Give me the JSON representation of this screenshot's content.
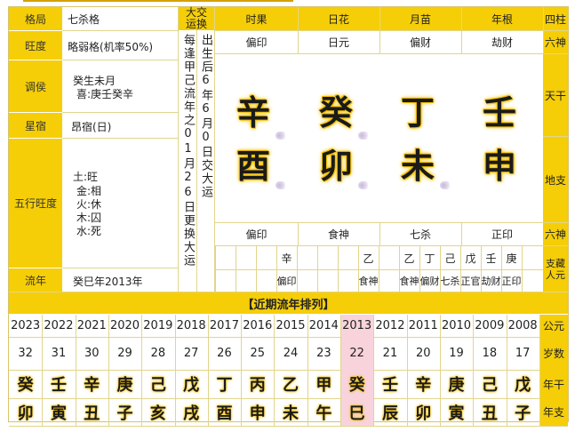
{
  "left": {
    "rows": [
      {
        "label": "格局",
        "value": "七杀格"
      },
      {
        "label": "旺度",
        "value": "略弱格(机率50%)"
      },
      {
        "label": "调侯",
        "lines": [
          "癸生未月",
          "喜:庚壬癸辛"
        ]
      },
      {
        "label": "星宿",
        "value": "昂宿(日)"
      },
      {
        "label": "五行旺度",
        "lines": [
          "土:旺",
          "金:相",
          "火:休",
          "木:囚",
          "水:死"
        ]
      },
      {
        "label": "流年",
        "value": "癸巳年2013年"
      }
    ]
  },
  "dayun": {
    "header": "大交运换",
    "col1": "每逢甲己流年之01月26日更换大运",
    "col2": "出生后6年6月0日交大运"
  },
  "pillars": {
    "headers": [
      "时果",
      "日花",
      "月苗",
      "年根"
    ],
    "row_label_pillars": "四柱",
    "shishen_label": "六神",
    "shishen": [
      "偏印",
      "日元",
      "偏财",
      "劫财"
    ],
    "tiangan_label": "天干",
    "tiangan": [
      "辛",
      "癸",
      "丁",
      "壬"
    ],
    "dizhi_label": "地支",
    "dizhi": [
      "酉",
      "卯",
      "未",
      "申"
    ],
    "dizhi_shishen_label": "六神",
    "dizhi_shishen": [
      "偏印",
      "食神",
      "七杀",
      "正印"
    ],
    "canggan_label": "支藏人元",
    "canggan": [
      [
        "",
        "辛",
        "",
        ""
      ],
      [
        "",
        "",
        "",
        "乙"
      ],
      [
        "乙",
        "丁",
        "己",
        "戊"
      ],
      [
        "壬",
        "庚"
      ]
    ],
    "canggan_shishen": [
      [
        "",
        "偏印",
        "",
        ""
      ],
      [
        "",
        "",
        "",
        "食神"
      ],
      [
        "食神",
        "偏财",
        "七杀",
        "正官"
      ],
      [
        "劫财",
        "正印"
      ]
    ]
  },
  "liunian": {
    "title": "【近期流年排列】",
    "years": [
      "2023",
      "2022",
      "2021",
      "2020",
      "2019",
      "2018",
      "2017",
      "2016",
      "2015",
      "2014",
      "2013",
      "2012",
      "2011",
      "2010",
      "2009",
      "2008"
    ],
    "ages": [
      "32",
      "31",
      "30",
      "29",
      "28",
      "27",
      "26",
      "25",
      "24",
      "23",
      "22",
      "21",
      "20",
      "19",
      "18",
      "17"
    ],
    "gan": [
      "癸",
      "壬",
      "辛",
      "庚",
      "己",
      "戊",
      "丁",
      "丙",
      "乙",
      "甲",
      "癸",
      "壬",
      "辛",
      "庚",
      "己",
      "戊"
    ],
    "zhi": [
      "卯",
      "寅",
      "丑",
      "子",
      "亥",
      "戌",
      "酉",
      "申",
      "未",
      "午",
      "巳",
      "辰",
      "卯",
      "寅",
      "丑",
      "子"
    ],
    "labels": [
      "公元",
      "岁数",
      "年干",
      "年支"
    ],
    "highlight_year": "2013"
  }
}
